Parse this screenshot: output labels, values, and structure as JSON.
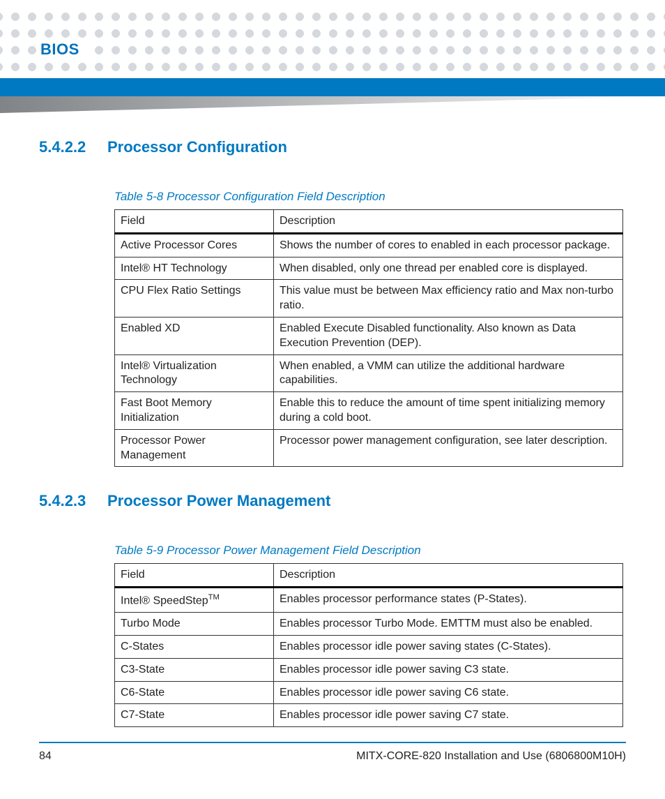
{
  "header": {
    "chapter": "BIOS"
  },
  "sections": [
    {
      "number": "5.4.2.2",
      "title": "Processor Configuration",
      "table_caption": "Table 5-8  Processor Configuration Field Description",
      "columns": {
        "field": "Field",
        "desc": "Description"
      },
      "rows": [
        {
          "field": "Active Processor Cores",
          "desc": "Shows the number of cores to enabled in each processor package."
        },
        {
          "field": "Intel® HT Technology",
          "desc": "When disabled, only one thread per enabled core is displayed."
        },
        {
          "field": "CPU Flex Ratio Settings",
          "desc": "This value must be between Max efficiency ratio and Max non-turbo ratio."
        },
        {
          "field": "Enabled XD",
          "desc": "Enabled Execute Disabled functionality. Also known as Data Execution Prevention (DEP)."
        },
        {
          "field": "Intel® Virtualization Technology",
          "desc": "When enabled, a VMM can utilize the additional hardware capabilities."
        },
        {
          "field": "Fast Boot Memory Initialization",
          "desc": "Enable this to reduce the amount of time spent initializing memory during a cold boot."
        },
        {
          "field": "Processor Power Management",
          "desc": "Processor power management configuration, see later description."
        }
      ]
    },
    {
      "number": "5.4.2.3",
      "title": "Processor Power Management",
      "table_caption": "Table 5-9  Processor Power Management Field Description",
      "columns": {
        "field": "Field",
        "desc": "Description"
      },
      "rows": [
        {
          "field_html": "Intel® SpeedStep<sup>TM</sup>",
          "field": "Intel® SpeedStepTM",
          "desc": "Enables processor performance states (P-States)."
        },
        {
          "field": "Turbo Mode",
          "desc": "Enables processor Turbo Mode. EMTTM must also be enabled."
        },
        {
          "field": "C-States",
          "desc": "Enables processor idle power saving states (C-States)."
        },
        {
          "field": "C3-State",
          "desc": "Enables processor idle power saving C3 state."
        },
        {
          "field": "C6-State",
          "desc": "Enables processor idle power saving C6 state."
        },
        {
          "field": "C7-State",
          "desc": "Enables processor idle power saving C7 state."
        }
      ]
    }
  ],
  "footer": {
    "page": "84",
    "doc": "MITX-CORE-820 Installation and Use (6806800M10H)"
  }
}
